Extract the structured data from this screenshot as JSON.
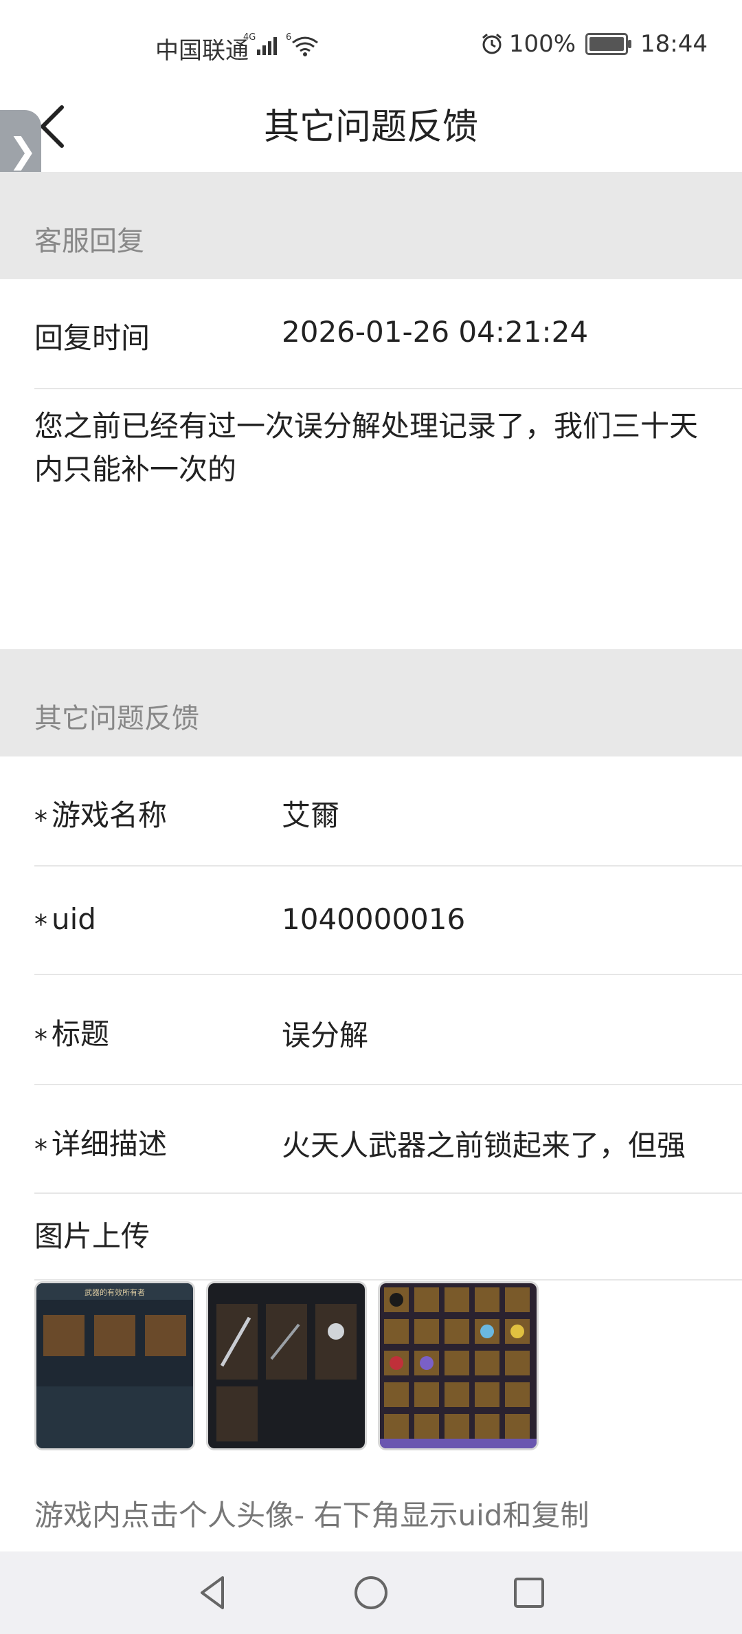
{
  "status_bar": {
    "carrier": "中国联通",
    "battery": "100%",
    "time": "18:44"
  },
  "header": {
    "title": "其它问题反馈"
  },
  "reply_section": {
    "heading": "客服回复",
    "time_label": "回复时间",
    "time_value": "2026-01-26 04:21:24",
    "message": "您之前已经有过一次误分解处理记录了，我们三十天内只能补一次的"
  },
  "feedback_section": {
    "heading": "其它问题反馈",
    "fields": [
      {
        "label": "游戏名称",
        "value": "艾爾",
        "required": true
      },
      {
        "label": "uid",
        "value": "1040000016",
        "required": true
      },
      {
        "label": "标题",
        "value": "误分解",
        "required": true
      },
      {
        "label": "详细描述",
        "value": "火天人武器之前锁起来了，但强",
        "required": true
      }
    ],
    "upload_label": "图片上传",
    "thumb_titles": [
      "武器的有效所有者"
    ],
    "hint": "游戏内点击个人头像- 右下角显示uid和复制",
    "required_mark": "*"
  },
  "colors": {
    "section_bg": "#e8e8e8",
    "divider": "#e6e6e6",
    "nav_bg": "#f0f0f3"
  }
}
